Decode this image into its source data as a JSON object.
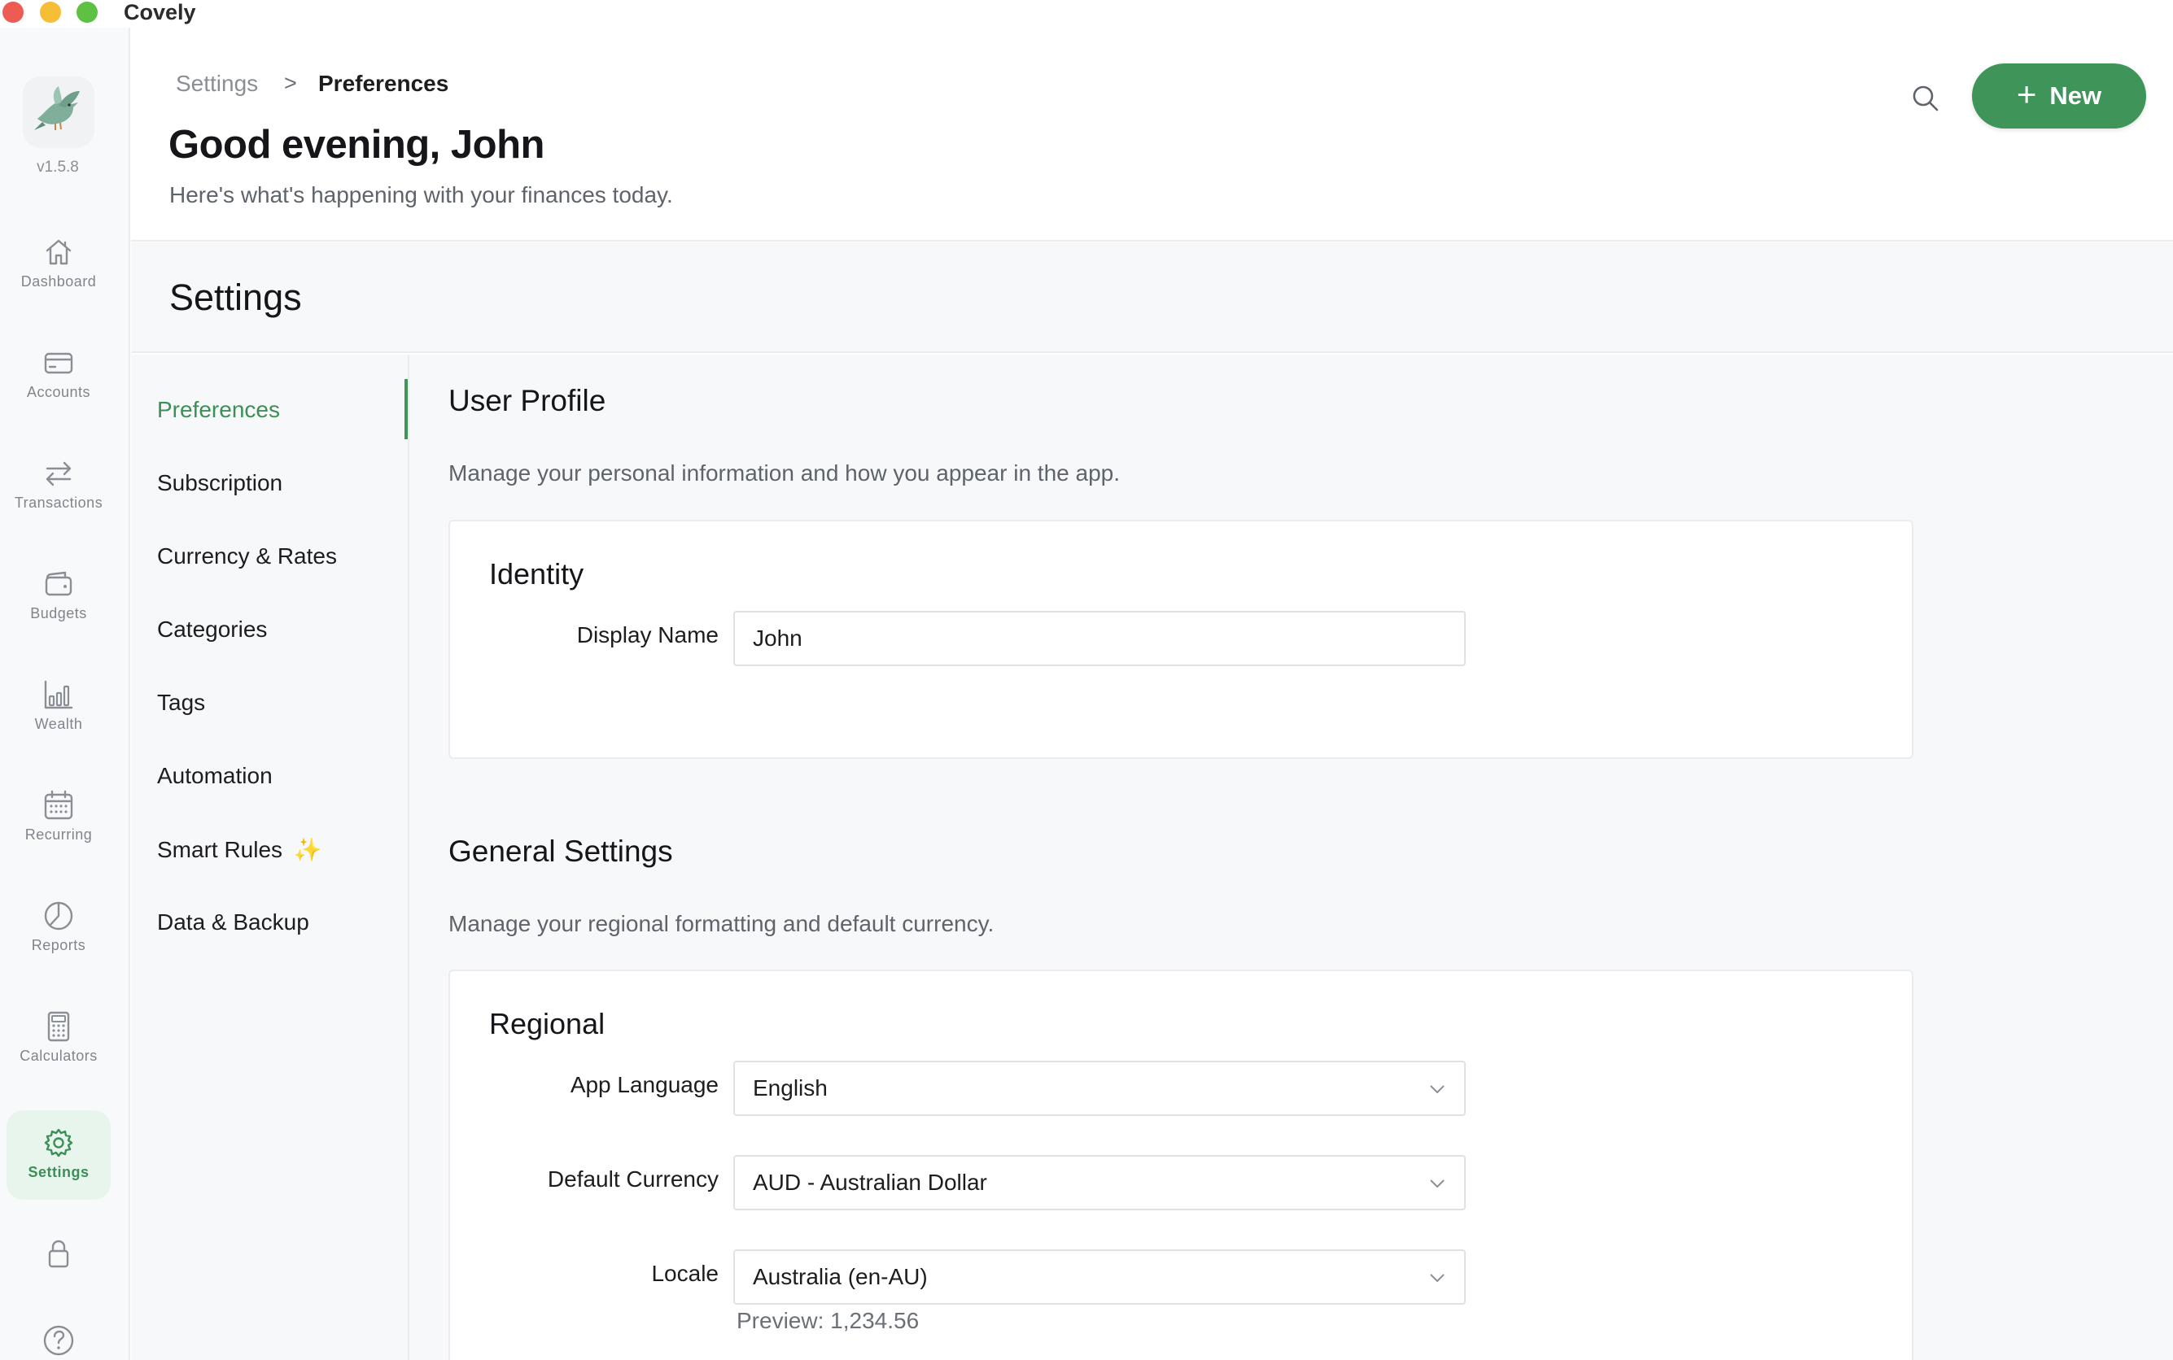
{
  "window": {
    "title": "Covely"
  },
  "rail": {
    "version": "v1.5.8",
    "items": [
      {
        "label": "Dashboard",
        "icon": "home-icon"
      },
      {
        "label": "Accounts",
        "icon": "card-icon"
      },
      {
        "label": "Transactions",
        "icon": "arrows-icon"
      },
      {
        "label": "Budgets",
        "icon": "wallet-icon"
      },
      {
        "label": "Wealth",
        "icon": "bar-chart-icon"
      },
      {
        "label": "Recurring",
        "icon": "calendar-icon"
      },
      {
        "label": "Reports",
        "icon": "pie-chart-icon"
      },
      {
        "label": "Calculators",
        "icon": "calculator-icon"
      },
      {
        "label": "Settings",
        "icon": "gear-icon",
        "active": true
      }
    ]
  },
  "header": {
    "breadcrumb": {
      "root": "Settings",
      "separator": ">",
      "current": "Preferences"
    },
    "greeting": "Good evening, John",
    "subtitle": "Here's what's happening with your finances today.",
    "new_button": {
      "icon": "+",
      "label": "New"
    }
  },
  "settings": {
    "title": "Settings",
    "nav": [
      {
        "label": "Preferences",
        "active": true
      },
      {
        "label": "Subscription"
      },
      {
        "label": "Currency & Rates"
      },
      {
        "label": "Categories"
      },
      {
        "label": "Tags"
      },
      {
        "label": "Automation"
      },
      {
        "label": "Smart Rules",
        "badge": "✨"
      },
      {
        "label": "Data & Backup"
      }
    ],
    "user_profile": {
      "title": "User Profile",
      "description": "Manage your personal information and how you appear in the app.",
      "identity": {
        "title": "Identity",
        "display_name_label": "Display Name",
        "display_name_value": "John"
      }
    },
    "general": {
      "title": "General Settings",
      "description": "Manage your regional formatting and default currency.",
      "regional": {
        "title": "Regional",
        "language_label": "App Language",
        "language_value": "English",
        "currency_label": "Default Currency",
        "currency_value": "AUD - Australian Dollar",
        "locale_label": "Locale",
        "locale_value": "Australia (en-AU)",
        "preview": "Preview: 1,234.56"
      }
    }
  },
  "colors": {
    "accent": "#3e9459",
    "accent_soft": "#e8f5ec",
    "muted": "#8a8f96"
  }
}
